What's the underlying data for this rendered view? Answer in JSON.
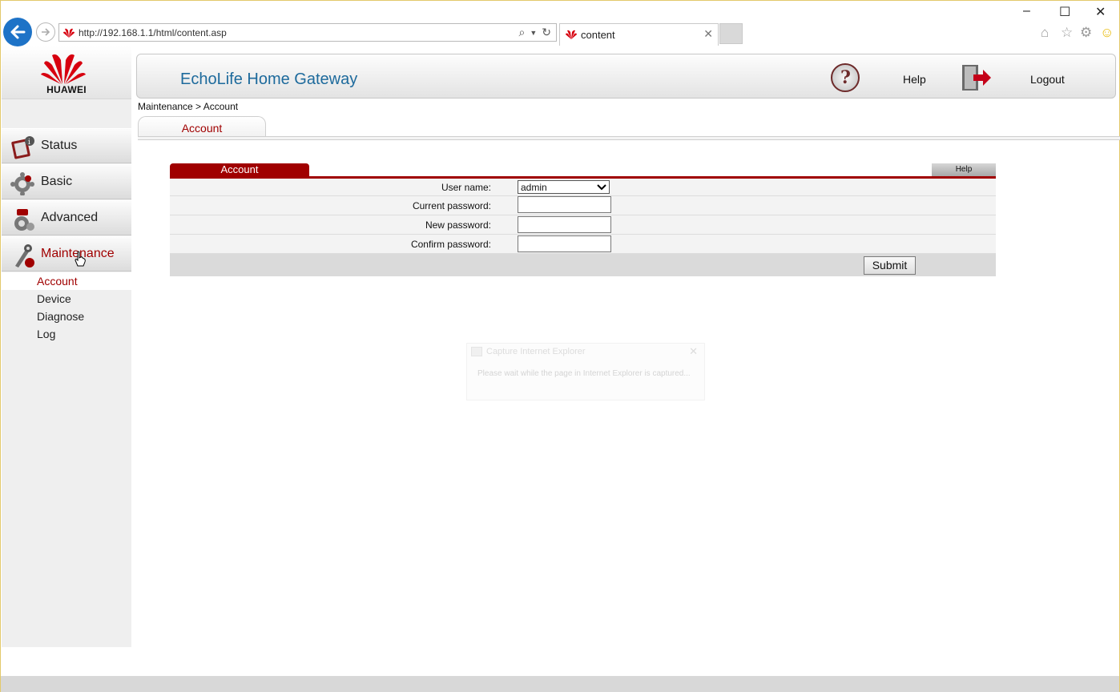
{
  "browser": {
    "url": "http://192.168.1.1/html/content.asp",
    "tab_label": "content",
    "tab_close": "✕",
    "window_controls": {
      "minimize": "–",
      "maximize": "☐",
      "close": "✕"
    }
  },
  "sidebar": {
    "logo_text": "HUAWEI",
    "nav": [
      {
        "label": "Status",
        "icon": "status-icon"
      },
      {
        "label": "Basic",
        "icon": "gear-icon"
      },
      {
        "label": "Advanced",
        "icon": "advanced-icon"
      },
      {
        "label": "Maintenance",
        "icon": "maintenance-icon",
        "active": true
      }
    ],
    "subnav": [
      {
        "label": "Account",
        "active": true
      },
      {
        "label": "Device"
      },
      {
        "label": "Diagnose"
      },
      {
        "label": "Log"
      }
    ]
  },
  "header": {
    "title": "EchoLife Home Gateway",
    "help_label": "Help",
    "logout_label": "Logout"
  },
  "breadcrumb": "Maintenance > Account",
  "page_tab": "Account",
  "panel": {
    "title": "Account",
    "help_label": "Help",
    "fields": [
      {
        "label": "User name:",
        "type": "select",
        "value": "admin"
      },
      {
        "label": "Current password:",
        "type": "password",
        "value": ""
      },
      {
        "label": "New password:",
        "type": "password",
        "value": ""
      },
      {
        "label": "Confirm password:",
        "type": "password",
        "value": ""
      }
    ],
    "submit_label": "Submit"
  },
  "capture_dialog": {
    "title": "Capture Internet Explorer",
    "message": "Please wait while the page in Internet Explorer is captured...",
    "close": "✕"
  },
  "colors": {
    "accent": "#a00000",
    "title_blue": "#1d6a9c",
    "browser_blue": "#1e73c7"
  }
}
